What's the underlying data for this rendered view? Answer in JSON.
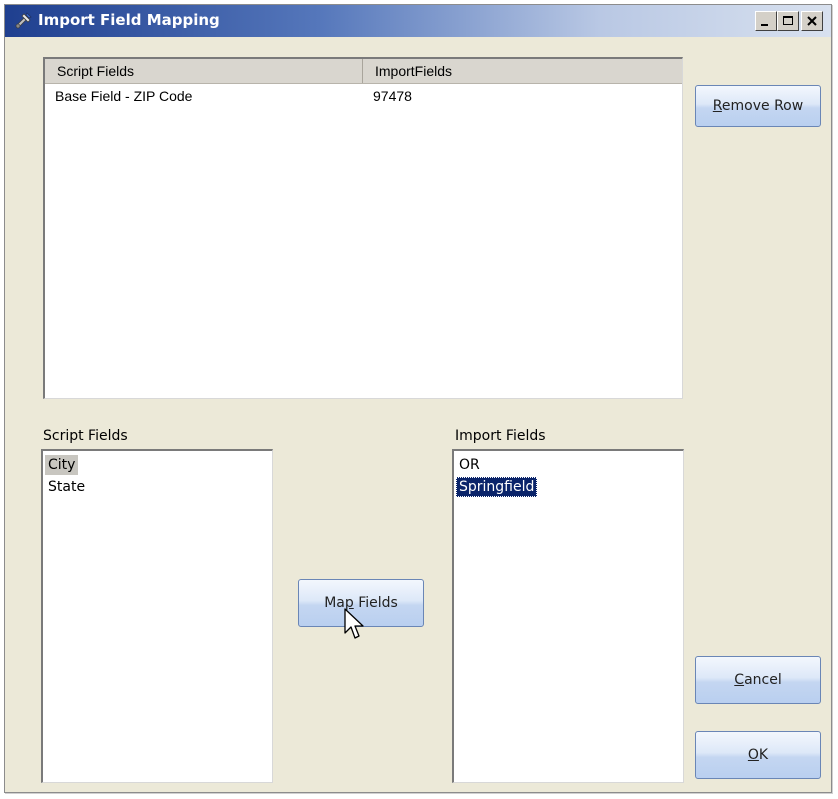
{
  "window": {
    "title": "Import Field Mapping"
  },
  "mapping_grid": {
    "columns": [
      "Script Fields",
      "ImportFields"
    ],
    "rows": [
      {
        "script_field": "Base Field - ZIP Code",
        "import_field": "97478"
      }
    ]
  },
  "script_fields_panel": {
    "label": "Script Fields",
    "items": [
      "City",
      "State"
    ],
    "selected": "City"
  },
  "import_fields_panel": {
    "label": "Import Fields",
    "items": [
      "OR",
      "Springfield"
    ],
    "selected": "Springfield"
  },
  "buttons": {
    "remove_row": {
      "mnemonic": "R",
      "rest": "emove Row"
    },
    "map_fields": {
      "pre": "Ma",
      "mnemonic": "p",
      "rest": " Fields"
    },
    "cancel": {
      "mnemonic": "C",
      "rest": "ancel"
    },
    "ok": {
      "mnemonic": "O",
      "rest": "K"
    }
  },
  "icons": {
    "app": "wrench-screwdriver-icon",
    "minimize": "minimize-icon",
    "maximize": "maximize-icon",
    "close": "close-icon",
    "cursor": "mouse-pointer-icon"
  }
}
